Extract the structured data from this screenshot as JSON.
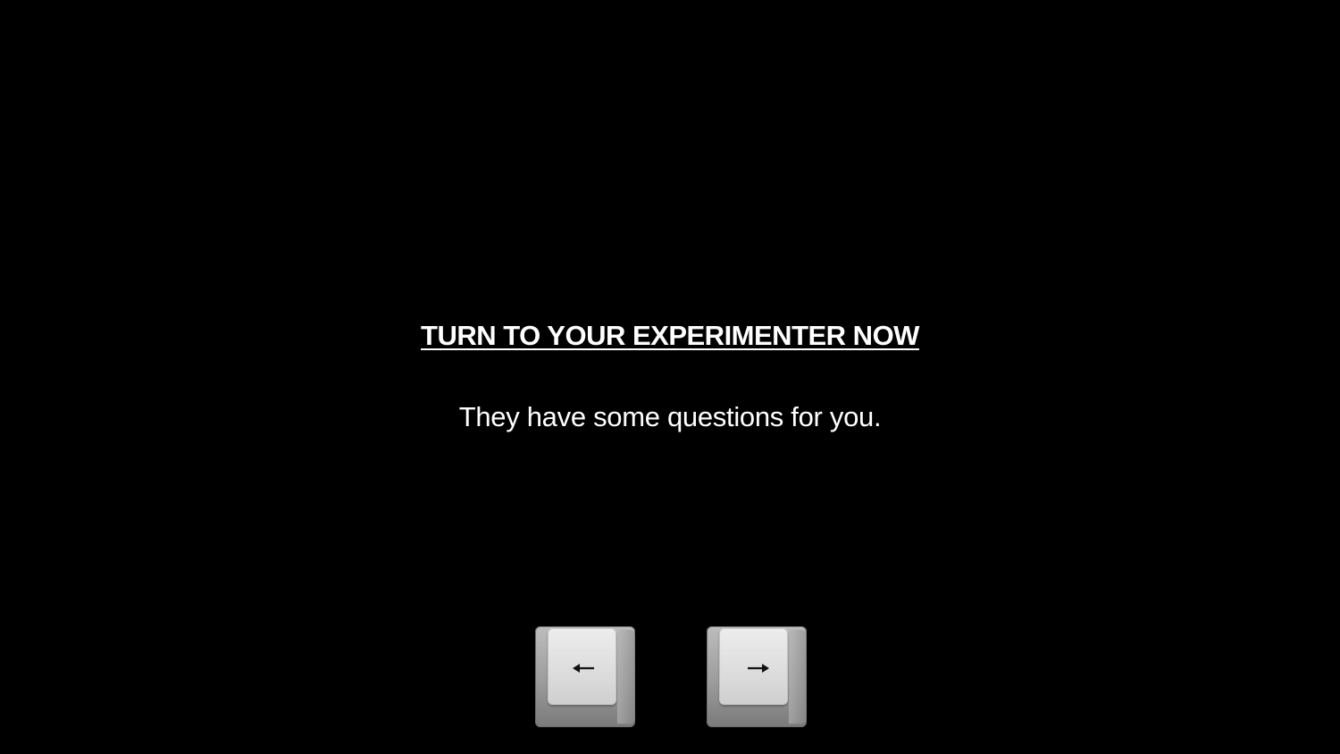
{
  "screen": {
    "heading": "TURN TO YOUR EXPERIMENTER NOW",
    "subtext": "They have some questions for you."
  },
  "keys": [
    {
      "name": "left-arrow-key",
      "icon": "left-arrow-icon"
    },
    {
      "name": "right-arrow-key",
      "icon": "right-arrow-icon"
    }
  ],
  "colors": {
    "background": "#000000",
    "text": "#ffffff",
    "key": "#dcdcdc"
  }
}
